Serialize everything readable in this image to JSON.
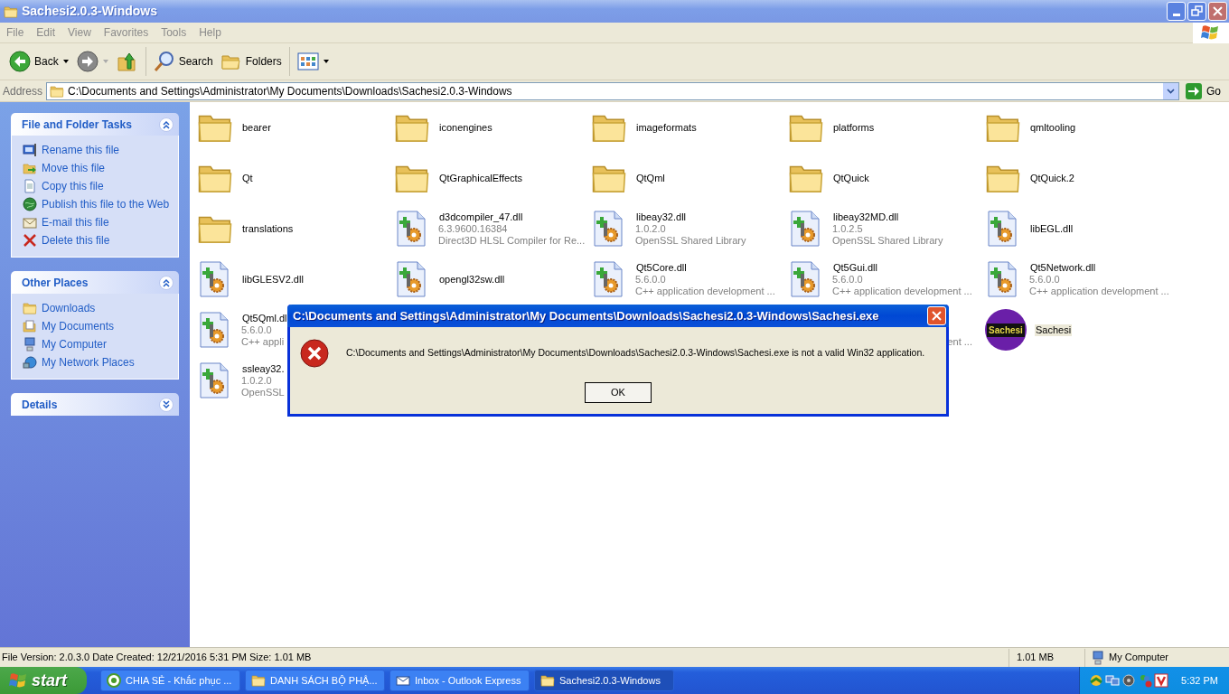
{
  "window": {
    "title": "Sachesi2.0.3-Windows"
  },
  "menu": [
    "File",
    "Edit",
    "View",
    "Favorites",
    "Tools",
    "Help"
  ],
  "toolbar": [
    {
      "kind": "back",
      "label": "Back",
      "disabled": false
    },
    {
      "kind": "forward",
      "disabled": true
    },
    {
      "kind": "up",
      "disabled": false
    },
    {
      "kind": "search",
      "label": "Search",
      "disabled": false
    },
    {
      "kind": "folders",
      "label": "Folders",
      "disabled": false
    },
    {
      "kind": "views",
      "disabled": false
    }
  ],
  "address": {
    "label": "Address",
    "value": "C:\\Documents and Settings\\Administrator\\My Documents\\Downloads\\Sachesi2.0.3-Windows",
    "go": "Go"
  },
  "sidebar": {
    "panels": [
      {
        "title": "File and Folder Tasks",
        "expanded": true,
        "items": [
          {
            "label": "Rename this file"
          },
          {
            "label": "Move this file"
          },
          {
            "label": "Copy this file"
          },
          {
            "label": "Publish this file to the Web"
          },
          {
            "label": "E-mail this file"
          },
          {
            "label": "Delete this file"
          }
        ]
      },
      {
        "title": "Other Places",
        "expanded": true,
        "items": [
          {
            "label": "Downloads"
          },
          {
            "label": "My Documents"
          },
          {
            "label": "My Computer"
          },
          {
            "label": "My Network Places"
          }
        ]
      },
      {
        "title": "Details",
        "expanded": false
      }
    ]
  },
  "files": [
    {
      "kind": "folder",
      "name": "bearer",
      "selected": false
    },
    {
      "kind": "folder",
      "name": "iconengines",
      "selected": false
    },
    {
      "kind": "folder",
      "name": "imageformats",
      "selected": false
    },
    {
      "kind": "folder",
      "name": "platforms",
      "selected": false
    },
    {
      "kind": "folder",
      "name": "qmltooling",
      "selected": false
    },
    {
      "kind": "folder",
      "name": "Qt",
      "selected": false
    },
    {
      "kind": "folder",
      "name": "QtGraphicalEffects",
      "selected": false
    },
    {
      "kind": "folder",
      "name": "QtQml",
      "selected": false
    },
    {
      "kind": "folder",
      "name": "QtQuick",
      "selected": false
    },
    {
      "kind": "folder",
      "name": "QtQuick.2",
      "selected": false
    },
    {
      "kind": "folder",
      "name": "translations",
      "selected": false
    },
    {
      "kind": "dll",
      "name": "d3dcompiler_47.dll",
      "version": "6.3.9600.16384",
      "description": "Direct3D HLSL Compiler for Re...",
      "selected": false
    },
    {
      "kind": "dll",
      "name": "libeay32.dll",
      "version": "1.0.2.0",
      "description": "OpenSSL Shared Library",
      "selected": false
    },
    {
      "kind": "dll",
      "name": "libeay32MD.dll",
      "version": "1.0.2.5",
      "description": "OpenSSL Shared Library",
      "selected": false
    },
    {
      "kind": "dll",
      "name": "libEGL.dll",
      "selected": false
    },
    {
      "kind": "dll",
      "name": "libGLESV2.dll",
      "selected": false
    },
    {
      "kind": "dll",
      "name": "opengl32sw.dll",
      "selected": false
    },
    {
      "kind": "dll",
      "name": "Qt5Core.dll",
      "version": "5.6.0.0",
      "description": "C++ application development ...",
      "selected": false
    },
    {
      "kind": "dll",
      "name": "Qt5Gui.dll",
      "version": "5.6.0.0",
      "description": "C++ application development ...",
      "selected": false
    },
    {
      "kind": "dll",
      "name": "Qt5Network.dll",
      "version": "5.6.0.0",
      "description": "C++ application development ...",
      "selected": false
    },
    {
      "kind": "dll",
      "name": "Qt5Qml.dl",
      "version": "5.6.0.0",
      "description": "C++ appli",
      "selected": false
    },
    {
      "kind": "fragment",
      "description": "ent ..."
    },
    {
      "kind": "app",
      "name": "Sachesi",
      "logo_text": "Sachesi",
      "selected": true
    },
    {
      "kind": "dll",
      "name": "ssleay32.",
      "version": "1.0.2.0",
      "description": "OpenSSL",
      "selected": false
    }
  ],
  "dialog": {
    "title": "C:\\Documents and Settings\\Administrator\\My Documents\\Downloads\\Sachesi2.0.3-Windows\\Sachesi.exe",
    "message": "C:\\Documents and Settings\\Administrator\\My Documents\\Downloads\\Sachesi2.0.3-Windows\\Sachesi.exe is not a valid Win32 application.",
    "button": "OK"
  },
  "status_bar": {
    "text": "File Version: 2.0.3.0 Date Created: 12/21/2016 5:31 PM Size: 1.01 MB",
    "size": "1.01 MB",
    "zone": "My Computer"
  },
  "taskbar": {
    "start": "start",
    "tasks": [
      {
        "label": "CHIA SẺ - Khắc phục ...",
        "active": false
      },
      {
        "label": "DANH SÁCH BỘ PHẬ...",
        "active": false
      },
      {
        "label": "Inbox - Outlook Express",
        "active": false
      },
      {
        "label": "Sachesi2.0.3-Windows",
        "active": true
      }
    ],
    "clock": "5:32 PM"
  }
}
